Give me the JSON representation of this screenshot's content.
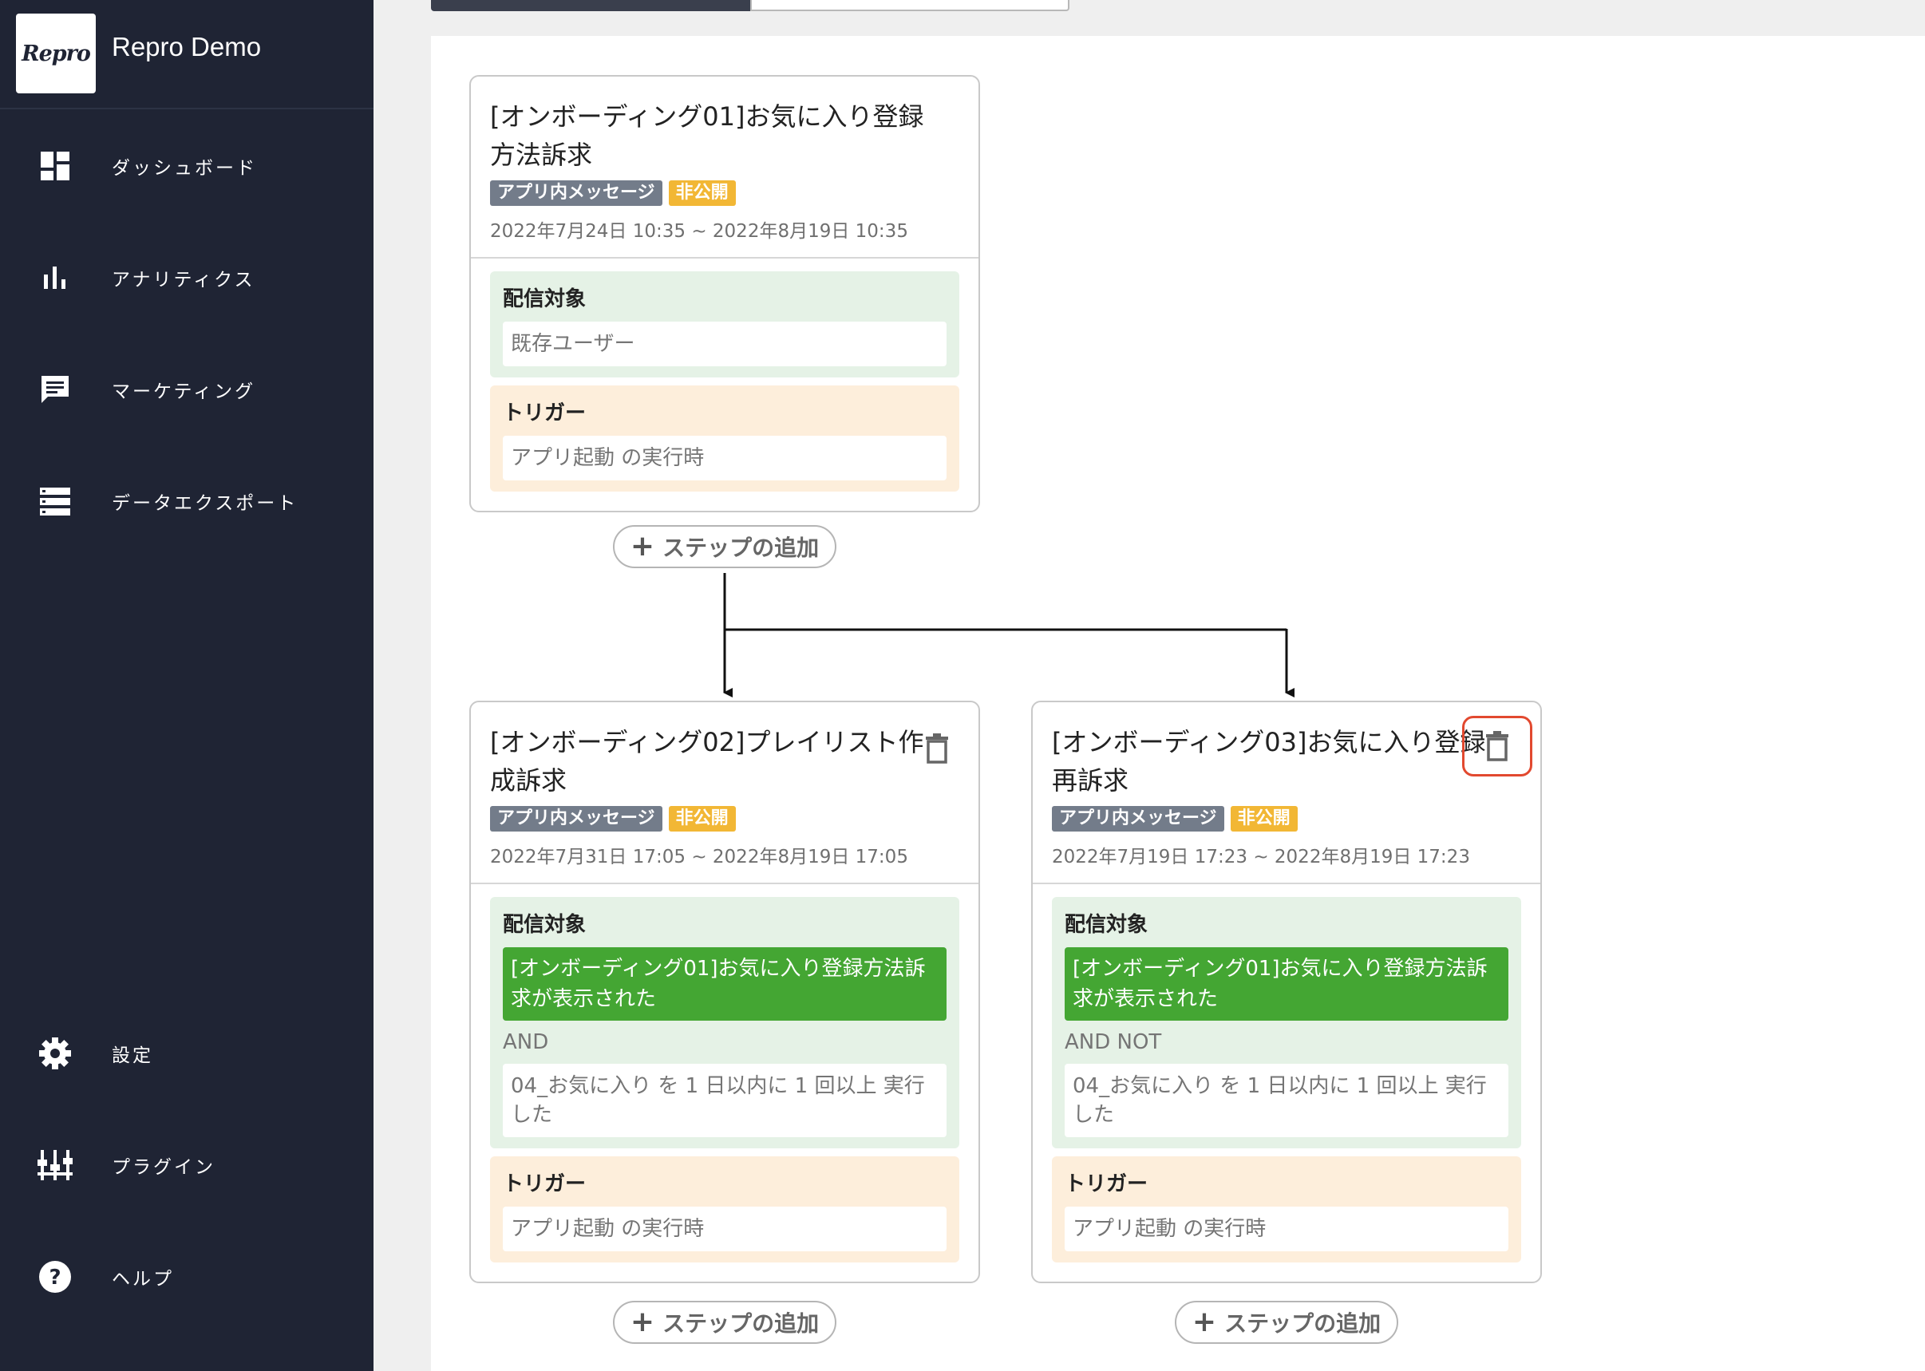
{
  "app": {
    "logo_text": "Repro",
    "name": "Repro Demo"
  },
  "sidebar": {
    "items": [
      {
        "label": "ダッシュボード",
        "icon": "dashboard-icon"
      },
      {
        "label": "アナリティクス",
        "icon": "bar-chart-icon"
      },
      {
        "label": "マーケティング",
        "icon": "message-icon"
      },
      {
        "label": "データエクスポート",
        "icon": "storage-icon"
      },
      {
        "label": "設定",
        "icon": "gear-icon"
      },
      {
        "label": "プラグイン",
        "icon": "plugin-icon"
      },
      {
        "label": "ヘルプ",
        "icon": "help-icon"
      }
    ]
  },
  "add_step_label": "ステップの追加",
  "cards": [
    {
      "title": "[オンボーディング01]お気に入り登録方法訴求",
      "type_badge": "アプリ内メッセージ",
      "status_badge": "非公開",
      "date_range": "2022年7月24日 10:35 ~ 2022年8月19日 10:35",
      "target_label": "配信対象",
      "target_value": "既存ユーザー",
      "trigger_label": "トリガー",
      "trigger_value": "アプリ起動 の実行時"
    },
    {
      "title": "[オンボーディング02]プレイリスト作成訴求",
      "type_badge": "アプリ内メッセージ",
      "status_badge": "非公開",
      "date_range": "2022年7月31日 17:05 ~ 2022年8月19日 17:05",
      "target_label": "配信対象",
      "target_condition": "[オンボーディング01]お気に入り登録方法訴求が表示された",
      "logic": "AND",
      "target_value": "04_お気に入り を 1 日以内に 1 回以上 実行した",
      "trigger_label": "トリガー",
      "trigger_value": "アプリ起動 の実行時"
    },
    {
      "title": "[オンボーディング03]お気に入り登録再訴求",
      "type_badge": "アプリ内メッセージ",
      "status_badge": "非公開",
      "date_range": "2022年7月19日 17:23 ~ 2022年8月19日 17:23",
      "target_label": "配信対象",
      "target_condition": "[オンボーディング01]お気に入り登録方法訴求が表示された",
      "logic": "AND NOT",
      "target_value": "04_お気に入り を 1 日以内に 1 回以上 実行した",
      "trigger_label": "トリガー",
      "trigger_value": "アプリ起動 の実行時"
    }
  ],
  "colors": {
    "sidebar_bg": "#1f2434",
    "badge_type": "#737c8a",
    "badge_status": "#f2b735",
    "condition_green": "#44a633",
    "target_bg": "#e5f2e6",
    "trigger_bg": "#fdeedb",
    "delete_highlight": "#e2492f"
  }
}
